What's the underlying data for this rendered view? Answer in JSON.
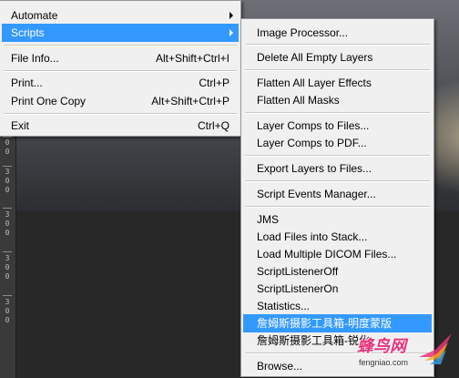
{
  "file_menu": {
    "items": [
      {
        "label": "Automate",
        "shortcut": "",
        "submenu": true
      },
      {
        "label": "Scripts",
        "shortcut": "",
        "submenu": true,
        "highlighted": true
      },
      {
        "label": "File Info...",
        "shortcut": "Alt+Shift+Ctrl+I"
      },
      {
        "label": "Print...",
        "shortcut": "Ctrl+P"
      },
      {
        "label": "Print One Copy",
        "shortcut": "Alt+Shift+Ctrl+P"
      },
      {
        "label": "Exit",
        "shortcut": "Ctrl+Q"
      }
    ]
  },
  "scripts_menu": {
    "items": [
      {
        "label": "Image Processor..."
      },
      {
        "label": "Delete All Empty Layers"
      },
      {
        "label": "Flatten All Layer Effects"
      },
      {
        "label": "Flatten All Masks"
      },
      {
        "label": "Layer Comps to Files..."
      },
      {
        "label": "Layer Comps to PDF..."
      },
      {
        "label": "Export Layers to Files..."
      },
      {
        "label": "Script Events Manager..."
      },
      {
        "label": "JMS"
      },
      {
        "label": "Load Files into Stack..."
      },
      {
        "label": "Load Multiple DICOM Files..."
      },
      {
        "label": "ScriptListenerOff"
      },
      {
        "label": "ScriptListenerOn"
      },
      {
        "label": "Statistics..."
      },
      {
        "label": "詹姆斯摄影工具箱-明度蒙版",
        "highlighted": true
      },
      {
        "label": "詹姆斯摄影工具箱-锐化"
      },
      {
        "label": "Browse..."
      }
    ]
  },
  "ruler": {
    "labels": [
      "0",
      "0",
      "3",
      "0",
      "0",
      "3",
      "0",
      "0",
      "3",
      "0",
      "0",
      "3",
      "0",
      "0"
    ]
  },
  "watermark": {
    "title": "蜂鸟网",
    "url": "fengniao.com"
  },
  "colors": {
    "highlight": "#3399ff",
    "menu_bg": "#f0f0f0",
    "watermark": "#e9337a"
  }
}
